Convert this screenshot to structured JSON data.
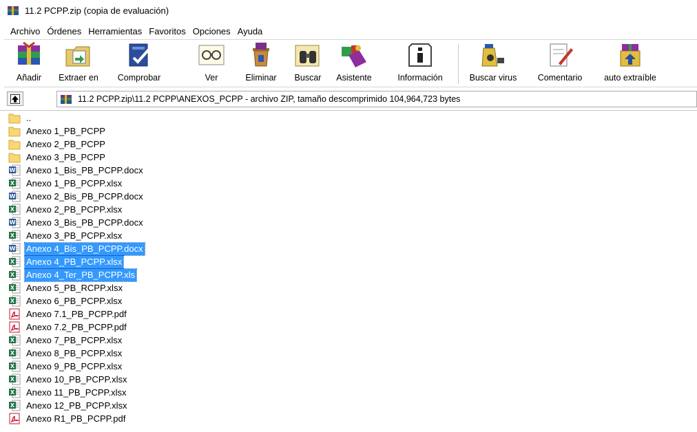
{
  "window": {
    "title": "11.2 PCPP.zip (copia de evaluación)"
  },
  "menu": [
    "Archivo",
    "Órdenes",
    "Herramientas",
    "Favoritos",
    "Opciones",
    "Ayuda"
  ],
  "toolbar": {
    "add": "Añadir",
    "extract": "Extraer en",
    "test": "Comprobar",
    "view": "Ver",
    "delete": "Eliminar",
    "find": "Buscar",
    "wizard": "Asistente",
    "info": "Información",
    "virus": "Buscar virus",
    "comment": "Comentario",
    "sfx": "auto extraíble"
  },
  "address": {
    "path": "11.2 PCPP.zip\\11.2 PCPP\\ANEXOS_PCPP - archivo ZIP, tamaño descomprimido 104,964,723 bytes"
  },
  "files": [
    {
      "name": "..",
      "type": "folder"
    },
    {
      "name": "Anexo 1_PB_PCPP",
      "type": "folder"
    },
    {
      "name": "Anexo 2_PB_PCPP",
      "type": "folder"
    },
    {
      "name": "Anexo 3_PB_PCPP",
      "type": "folder"
    },
    {
      "name": "Anexo 1_Bis_PB_PCPP.docx",
      "type": "word"
    },
    {
      "name": "Anexo 1_PB_PCPP.xlsx",
      "type": "excel"
    },
    {
      "name": "Anexo 2_Bis_PB_PCPP.docx",
      "type": "word"
    },
    {
      "name": "Anexo 2_PB_PCPP.xlsx",
      "type": "excel"
    },
    {
      "name": "Anexo 3_Bis_PB_PCPP.docx",
      "type": "word"
    },
    {
      "name": "Anexo 3_PB_PCPP.xlsx",
      "type": "excel"
    },
    {
      "name": "Anexo 4_Bis_PB_PCPP.docx",
      "type": "word",
      "selected": true
    },
    {
      "name": "Anexo 4_PB_PCPP.xlsx",
      "type": "excel",
      "selected": true
    },
    {
      "name": "Anexo 4_Ter_PB_PCPP.xls",
      "type": "excel",
      "selected": true
    },
    {
      "name": "Anexo 5_PB_RCPP.xlsx",
      "type": "excel"
    },
    {
      "name": "Anexo 6_PB_PCPP.xlsx",
      "type": "excel"
    },
    {
      "name": "Anexo 7.1_PB_PCPP.pdf",
      "type": "pdf"
    },
    {
      "name": "Anexo 7.2_PB_PCPP.pdf",
      "type": "pdf"
    },
    {
      "name": "Anexo 7_PB_PCPP.xlsx",
      "type": "excel"
    },
    {
      "name": "Anexo 8_PB_PCPP.xlsx",
      "type": "excel"
    },
    {
      "name": "Anexo 9_PB_PCPP.xlsx",
      "type": "excel"
    },
    {
      "name": "Anexo 10_PB_PCPP.xlsx",
      "type": "excel"
    },
    {
      "name": "Anexo 11_PB_PCPP.xlsx",
      "type": "excel"
    },
    {
      "name": "Anexo 12_PB_PCPP.xlsx",
      "type": "excel"
    },
    {
      "name": "Anexo R1_PB_PCPP.pdf",
      "type": "pdf"
    }
  ],
  "colors": {
    "selection": "#3399ff",
    "folder": "#f8d775",
    "word": "#2b579a",
    "excel": "#217346",
    "pdf": "#c8102e"
  }
}
